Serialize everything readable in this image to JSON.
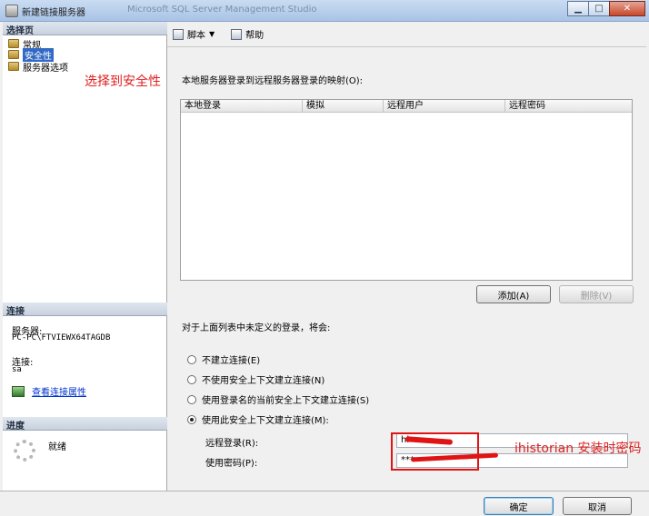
{
  "window": {
    "title": "新建链接服务器",
    "background_title": "Microsoft SQL Server Management Studio"
  },
  "left_pane": {
    "select_page_header": "选择页",
    "nav_items": [
      {
        "label": "常规"
      },
      {
        "label": "安全性",
        "selected": true
      },
      {
        "label": "服务器选项"
      }
    ],
    "connection_header": "连接",
    "server_label": "服务器:",
    "server_value": "PC-PC\\FTVIEWX64TAGDB",
    "connection_label": "连接:",
    "connection_value": "sa",
    "view_connection_link": "查看连接属性",
    "progress_header": "进度",
    "status": "就绪"
  },
  "toolbar": {
    "script_label": "脚本",
    "help_label": "帮助"
  },
  "mapping": {
    "label": "本地服务器登录到远程服务器登录的映射(O):",
    "columns": [
      "本地登录",
      "模拟",
      "远程用户",
      "远程密码"
    ],
    "add_button": "添加(A)",
    "delete_button": "删除(V)"
  },
  "undefined_logins": {
    "label": "对于上面列表中未定义的登录，将会:",
    "options": [
      {
        "label": "不建立连接(E)",
        "checked": false
      },
      {
        "label": "不使用安全上下文建立连接(N)",
        "checked": false
      },
      {
        "label": "使用登录名的当前安全上下文建立连接(S)",
        "checked": false
      },
      {
        "label": "使用此安全上下文建立连接(M):",
        "checked": true
      }
    ],
    "remote_login_label": "远程登录(R):",
    "remote_login_value": "hi",
    "password_label": "使用密码(P):",
    "password_value": "***"
  },
  "annotations": {
    "left_note": "选择到安全性",
    "right_note": "ihistorian 安装时密码"
  },
  "footer": {
    "ok_button": "确定",
    "cancel_button": "取消"
  },
  "colors": {
    "annotation_red": "#e01414",
    "selection_blue": "#316ac5",
    "link_blue": "#0033cc"
  }
}
